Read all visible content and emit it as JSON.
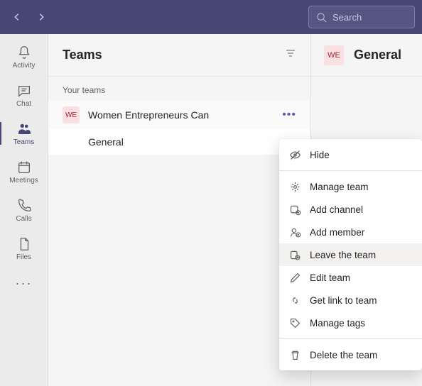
{
  "search": {
    "placeholder": "Search"
  },
  "rail": {
    "items": [
      {
        "label": "Activity"
      },
      {
        "label": "Chat"
      },
      {
        "label": "Teams"
      },
      {
        "label": "Meetings"
      },
      {
        "label": "Calls"
      },
      {
        "label": "Files"
      }
    ]
  },
  "teams_pane": {
    "title": "Teams",
    "section_label": "Your teams",
    "team": {
      "initials": "WE",
      "name": "Women Entrepreneurs Can"
    },
    "channel": {
      "name": "General"
    }
  },
  "content": {
    "avatar_initials": "WE",
    "title": "General"
  },
  "menu": {
    "hide": "Hide",
    "manage_team": "Manage team",
    "add_channel": "Add channel",
    "add_member": "Add member",
    "leave_team": "Leave the team",
    "edit_team": "Edit team",
    "get_link": "Get link to team",
    "manage_tags": "Manage tags",
    "delete_team": "Delete the team"
  },
  "colors": {
    "brand": "#464775",
    "avatar_bg": "#fadfe3",
    "avatar_fg": "#a4262c"
  }
}
